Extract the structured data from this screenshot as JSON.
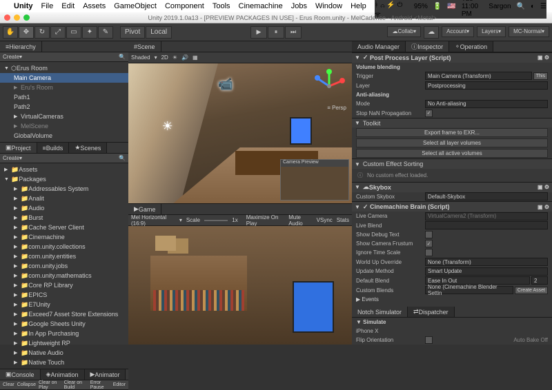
{
  "menubar": {
    "app": "Unity",
    "items": [
      "File",
      "Edit",
      "Assets",
      "GameObject",
      "Component",
      "Tools",
      "Cinemachine",
      "Jobs",
      "Window",
      "Help"
    ],
    "battery": "95%",
    "flag": "🇺🇸",
    "time": "Tue 11:00 PM",
    "user": "Sargon"
  },
  "titlebar": {
    "title": "Unity 2019.1.0a13 - [PREVIEW PACKAGES IN USE] - Erus Room.unity - MelCadence - Android <Metal>"
  },
  "toolbar": {
    "pivot": "Pivot",
    "local": "Local",
    "collab": "Collab",
    "account": "Account",
    "layers": "Layers",
    "layout": "MC-Normal"
  },
  "hierarchy": {
    "tab": "Hierarchy",
    "create": "Create",
    "root": "Erus Room",
    "items": [
      {
        "label": "Main Camera",
        "sel": true,
        "depth": 1
      },
      {
        "label": "Eru's Room",
        "dim": true,
        "depth": 1
      },
      {
        "label": "Path1",
        "depth": 1
      },
      {
        "label": "Path2",
        "depth": 1
      },
      {
        "label": "VirtualCameras",
        "depth": 1,
        "arrow": true
      },
      {
        "label": "MelScene",
        "dim": true,
        "depth": 1,
        "arrow": true
      },
      {
        "label": "GlobalVolume",
        "depth": 1
      }
    ]
  },
  "project": {
    "tabs": [
      "Project",
      "Builds",
      "Scenes"
    ],
    "create": "Create",
    "roots": [
      "Assets",
      "Packages"
    ],
    "items": [
      "Addressables System",
      "Analit",
      "Audio",
      "Burst",
      "Cache Server Client",
      "Cinemachine",
      "com.unity.collections",
      "com.unity.entities",
      "com.unity.jobs",
      "com.unity.mathematics",
      "Core RP Library",
      "EPICS",
      "E7Unity",
      "Exceed7 Asset Store Extensions",
      "Google Sheets Unity",
      "In App Purchasing",
      "Lightweight RP",
      "Native Audio",
      "Native Touch"
    ]
  },
  "console": {
    "tabs": [
      "Console",
      "Animation",
      "Animator"
    ],
    "btns": [
      "Clear",
      "Collapse",
      "Clear on Play",
      "Clear on Build",
      "Error Pause",
      "Editor"
    ]
  },
  "scene": {
    "tab": "Scene",
    "shaded": "Shaded",
    "mode": "2D",
    "persp": "Persp",
    "cam_preview": "Camera Preview"
  },
  "game": {
    "tab": "Game",
    "display": "Mel Horizontal (16:9)",
    "scale": "Scale",
    "scale_val": "1x",
    "opts": [
      "Maximize On Play",
      "Mute Audio",
      "VSync",
      "Stats"
    ]
  },
  "inspector": {
    "tabs": [
      "Audio Manager",
      "Inspector",
      "Operation"
    ],
    "components": [
      {
        "name": "Post Process Layer (Script)",
        "enabled": true,
        "section1": "Volume blending",
        "rows1": [
          {
            "lbl": "Trigger",
            "val": "Main Camera (Transform)",
            "btn": "This"
          },
          {
            "lbl": "Layer",
            "val": "Postprocessing"
          }
        ],
        "section2": "Anti-aliasing",
        "rows2": [
          {
            "lbl": "Mode",
            "val": "No Anti-aliasing"
          },
          {
            "lbl": "Stop NaN Propagation",
            "cb": true
          }
        ],
        "toolkit": "Toolkit",
        "toolkit_btns": [
          "Export frame to EXR...",
          "Select all layer volumes",
          "Select all active volumes"
        ],
        "sorting": "Custom Effect Sorting",
        "sorting_msg": "No custom effect loaded."
      },
      {
        "name": "Skybox",
        "row": {
          "lbl": "Custom Skybox",
          "val": "Default-Skybox"
        }
      },
      {
        "name": "Cinemachine Brain (Script)",
        "enabled": true,
        "rows": [
          {
            "lbl": "Live Camera",
            "val": "VirtualCamera2 (Transform)",
            "dim": true
          },
          {
            "lbl": "Live Blend",
            "val": "",
            "dim": true
          },
          {
            "lbl": "Show Debug Text",
            "cb": false
          },
          {
            "lbl": "Show Camera Frustum",
            "cb": true
          },
          {
            "lbl": "Ignore Time Scale",
            "cb": false
          },
          {
            "lbl": "World Up Override",
            "val": "None (Transform)"
          },
          {
            "lbl": "Update Method",
            "val": "Smart Update"
          },
          {
            "lbl": "Default Blend",
            "val": "Ease In Out",
            "num": "2"
          },
          {
            "lbl": "Custom Blends",
            "val": "None (Cinemachine Blender Settin",
            "btn": "Create Asset"
          }
        ],
        "events": "Events"
      },
      {
        "name": "Notch Simulator",
        "tab2": "Dispatcher",
        "section": "Simulate",
        "rows": [
          {
            "lbl": "iPhone X",
            "val": ""
          },
          {
            "lbl": "Flip Orientation",
            "cb": false
          }
        ]
      }
    ]
  },
  "footer": "Auto Bake Off"
}
